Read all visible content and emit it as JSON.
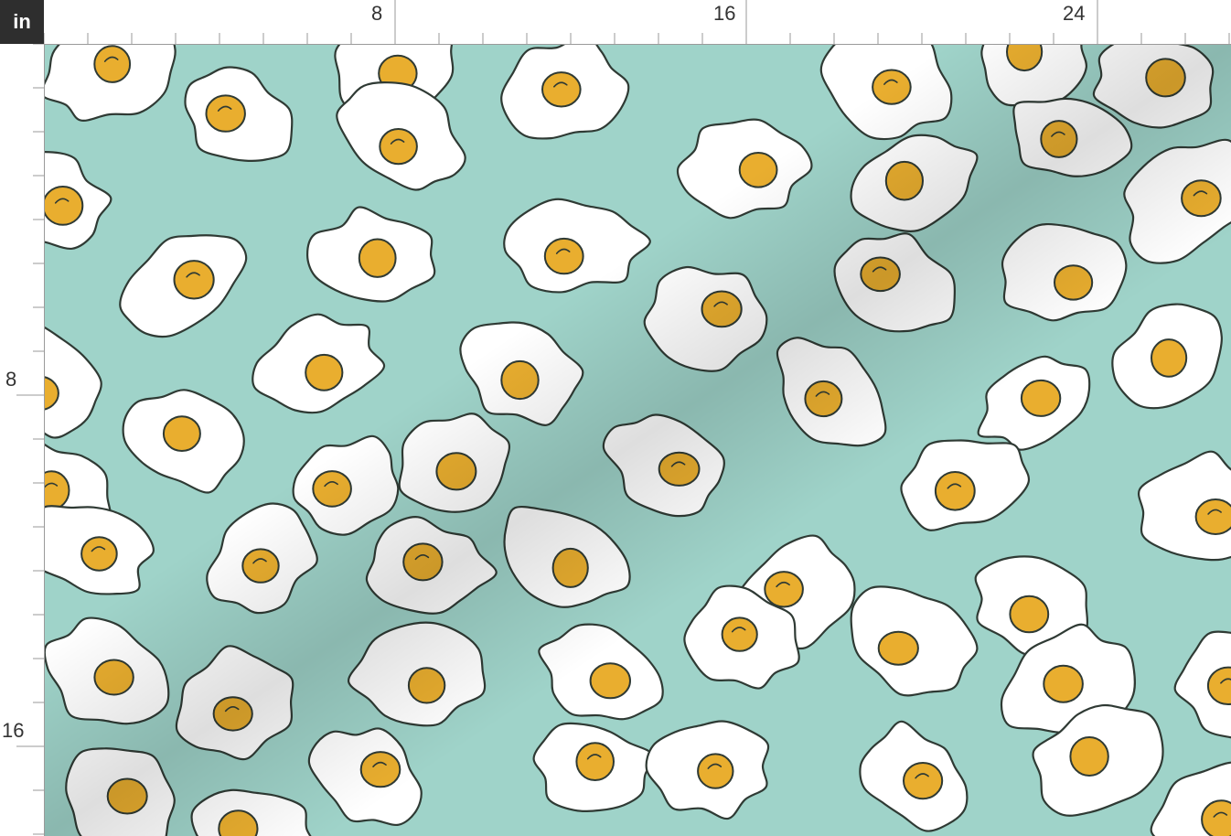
{
  "ruler": {
    "unit_label": "in",
    "top_labels": [
      "8",
      "16",
      "24"
    ],
    "left_labels": [
      "8",
      "16"
    ]
  },
  "fabric": {
    "pattern": "fried eggs",
    "background_color": "#9fd3c9",
    "white_color": "#ffffff",
    "yolk_color": "#e9ae2f",
    "outline_color": "#2f3a34"
  }
}
